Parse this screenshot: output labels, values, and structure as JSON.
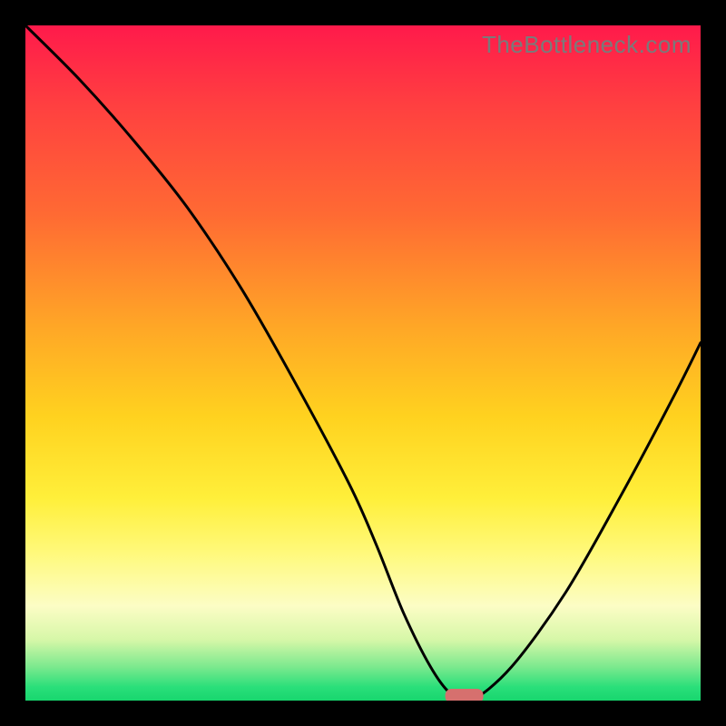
{
  "watermark": "TheBottleneck.com",
  "chart_data": {
    "type": "line",
    "title": "",
    "xlabel": "",
    "ylabel": "",
    "xlim": [
      0,
      100
    ],
    "ylim": [
      0,
      100
    ],
    "x": [
      0,
      8,
      16,
      24,
      32,
      40,
      48,
      52,
      56,
      60,
      63,
      66,
      72,
      80,
      88,
      96,
      100
    ],
    "values": [
      100,
      92,
      83,
      73,
      61,
      47,
      32,
      23,
      13,
      5,
      1,
      0,
      5,
      16,
      30,
      45,
      53
    ],
    "marker": {
      "x": 65,
      "y": 0,
      "shape": "pill"
    },
    "background_gradient": [
      "#ff1a4b",
      "#ffd21f",
      "#fcfdc5",
      "#18d66e"
    ]
  }
}
